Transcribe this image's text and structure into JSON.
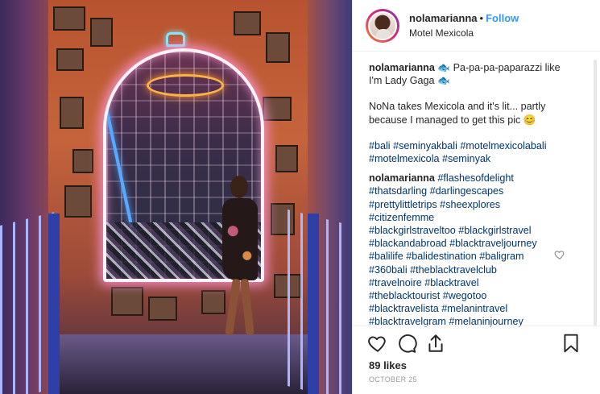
{
  "post": {
    "username": "nolamarianna",
    "separator": "•",
    "follow_label": "Follow",
    "location": "Motel Mexicola"
  },
  "caption": {
    "author": "nolamarianna",
    "line1": "🐟 Pa-pa-pa-paparazzi like",
    "line2": "I'm Lady Gaga 🐟",
    "line3": "NoNa takes Mexicola and it's lit... partly",
    "line4": "because I managed to get this pic 😊",
    "tags_line1": "#bali #seminyakbali #motelmexicolabali",
    "tags_line2": "#motelmexicola #seminyak"
  },
  "comment": {
    "author": "nolamarianna",
    "lines": [
      "#flashesofdelight",
      "#thatsdarling #darlingescapes",
      "#prettylittletrips #sheexplores",
      "#citizenfemme",
      "#blackgirlstraveltoo #blackgirlstravel",
      "#blackandabroad #blacktraveljourney",
      "#balilife #balidestination #baligram",
      "#360bali #theblacktravelclub",
      "#travelnoire #blacktravel",
      "#theblacktourist #wegotoo",
      "#blacktravelista #melanintravel",
      "#blacktravelgram #melaninjourney"
    ]
  },
  "stats": {
    "likes": "89 likes",
    "date": "OCTOBER 25"
  },
  "icons": {
    "like": "heart-icon",
    "comment": "comment-icon",
    "share": "share-icon",
    "save": "bookmark-icon",
    "comment_like": "heart-icon"
  },
  "colors": {
    "link": "#003569",
    "follow": "#3897f0",
    "text": "#262626",
    "muted": "#999999"
  }
}
